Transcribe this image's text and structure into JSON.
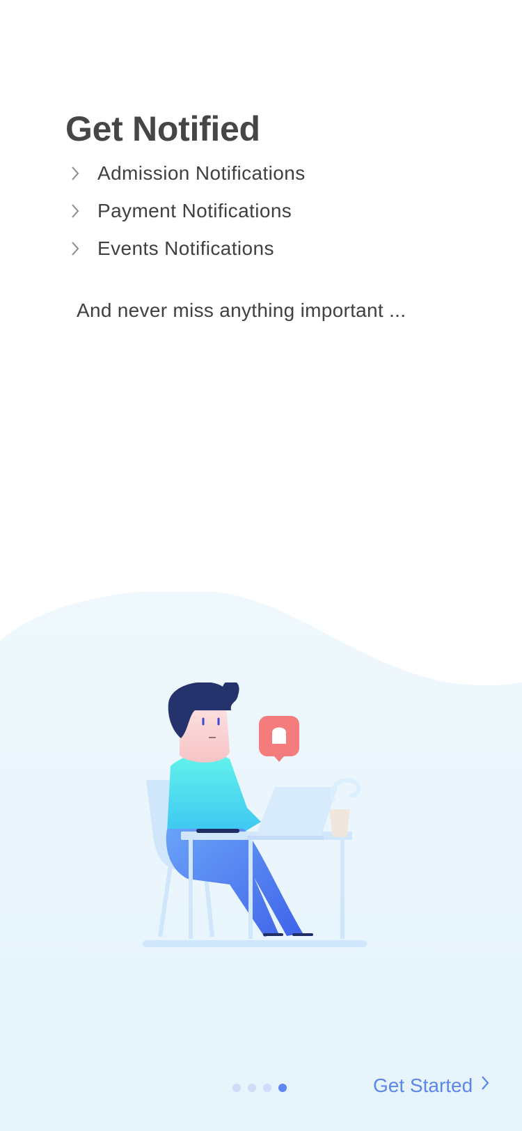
{
  "header": {
    "title": "Get Notified"
  },
  "features": [
    {
      "label": "Admission Notifications",
      "icon": "chevron-right-icon"
    },
    {
      "label": "Payment Notifications",
      "icon": "chevron-right-icon"
    },
    {
      "label": "Events Notifications",
      "icon": "chevron-right-icon"
    }
  ],
  "tagline": "And never miss anything important ...",
  "pager": {
    "total": 4,
    "current": 4
  },
  "cta": {
    "label": "Get Started",
    "icon": "chevron-right-icon"
  },
  "colors": {
    "accent": "#5b86ea",
    "title": "#464646",
    "wave": "#e8f5fc",
    "bell_badge": "#f47c7c"
  }
}
